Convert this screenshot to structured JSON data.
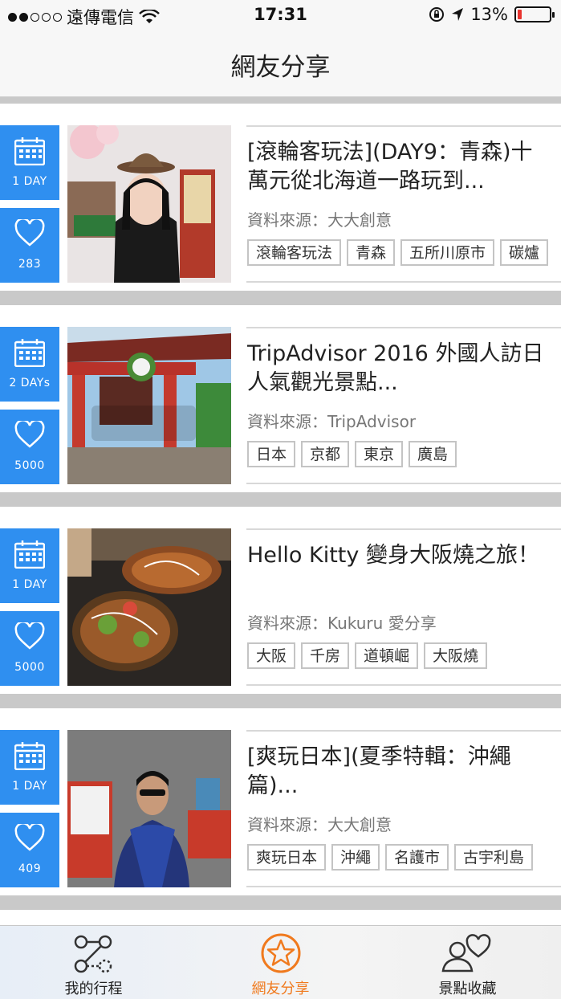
{
  "status": {
    "carrier": "遠傳電信",
    "time": "17:31",
    "battery": "13%",
    "battery_level": 0.13,
    "signal_bars": 2,
    "battery_color": "#e8332e"
  },
  "nav": {
    "title": "網友分享"
  },
  "colors": {
    "accent": "#2f8ff0",
    "active_tab": "#f07a1e"
  },
  "posts": [
    {
      "days": "1 DAY",
      "likes": "283",
      "title": "[滾輪客玩法](DAY9：青森)十萬元從北海道一路玩到...",
      "source": "資料來源：大大創意",
      "tags": [
        "滾輪客玩法",
        "青森",
        "五所川原市",
        "碳爐"
      ]
    },
    {
      "days": "2 DAYs",
      "likes": "5000",
      "title": "TripAdvisor 2016 外國人訪日人氣觀光景點...",
      "source": "資料來源：TripAdvisor",
      "tags": [
        "日本",
        "京都",
        "東京",
        "廣島"
      ]
    },
    {
      "days": "1 DAY",
      "likes": "5000",
      "title": "Hello Kitty 變身大阪燒之旅！",
      "source": "資料來源：Kukuru 愛分享",
      "tags": [
        "大阪",
        "千房",
        "道頓崛",
        "大阪燒"
      ]
    },
    {
      "days": "1 DAY",
      "likes": "409",
      "title": "[爽玩日本](夏季特輯：沖繩篇)...",
      "source": "資料來源：大大創意",
      "tags": [
        "爽玩日本",
        "沖繩",
        "名護市",
        "古宇利島"
      ]
    }
  ],
  "tabs": [
    {
      "label": "我的行程",
      "icon": "route-icon"
    },
    {
      "label": "網友分享",
      "icon": "star-icon"
    },
    {
      "label": "景點收藏",
      "icon": "user-heart-icon"
    }
  ]
}
